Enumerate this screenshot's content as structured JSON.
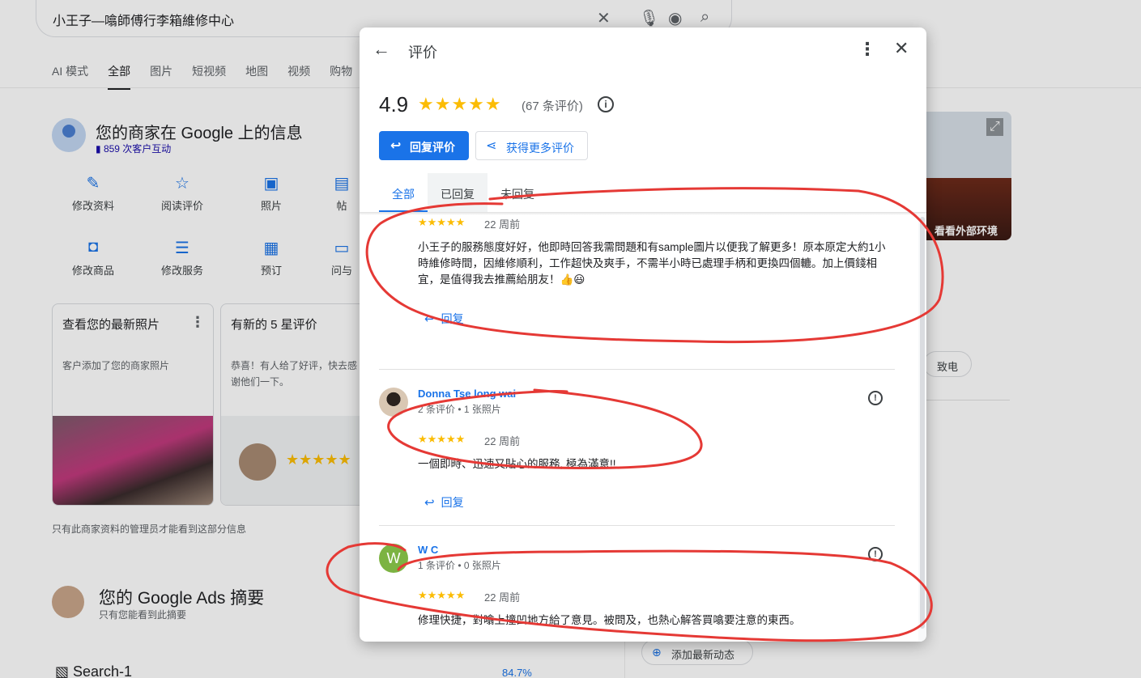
{
  "search": {
    "query": "小王子—噏師傅行李箱維修中心"
  },
  "nav_tabs": [
    "AI 模式",
    "全部",
    "图片",
    "短视频",
    "地图",
    "视频",
    "购物"
  ],
  "business": {
    "title": "您的商家在 Google 上的信息",
    "interactions": "859 次客户互动",
    "actions": [
      "修改资料",
      "阅读评价",
      "照片",
      "帖",
      "修改商品",
      "修改服务",
      "预订",
      "问与"
    ],
    "cards": [
      {
        "title": "查看您的最新照片",
        "desc": "客户添加了您的商家照片"
      },
      {
        "title": "有新的 5 星评价",
        "desc": "恭喜！有人给了好评，快去感谢他们一下。"
      }
    ],
    "note": "只有此商家资料的管理员才能看到这部分信息"
  },
  "ads": {
    "title": "您的 Google Ads 摘要",
    "subtitle": "只有您能看到此摘要",
    "campaign": "Search-1",
    "pct": "84.7%"
  },
  "side": {
    "map_label": "看看外部环境",
    "call": "致电",
    "add_update": "添加最新动态"
  },
  "modal": {
    "title": "评价",
    "rating": "4.9",
    "stars": "★★★★★",
    "count": "(67 条评价)",
    "reply_button": "回复评价",
    "more_reviews_button": "获得更多评价",
    "tabs": [
      "全部",
      "已回复",
      "未回复"
    ],
    "reply_label": "回复",
    "reviews": [
      {
        "name": "",
        "meta": "",
        "stars": "★★★★★",
        "when": "22 周前",
        "text": "小王子的服務態度好好，他即時回答我需問題和有sample圖片以便我了解更多！原本原定大約1小時維修時間，因維修順利，工作超快及爽手，不需半小時已處理手柄和更換四個轆。加上價錢相宜，是值得我去推薦給朋友！👍😃"
      },
      {
        "name": "Donna Tse long wai",
        "meta": "2 条评价 • 1 张照片",
        "stars": "★★★★★",
        "when": "22 周前",
        "text": "一個即時、迅速又貼心的服務, 極為滿意!!"
      },
      {
        "name": "W C",
        "initial": "W",
        "meta": "1 条评价 • 0 张照片",
        "stars": "★★★★★",
        "when": "22 周前",
        "text": "修理快捷，對噏上撞凹地方給了意見。被問及，也熱心解答買噏要注意的東西。"
      }
    ]
  },
  "colors": {
    "accent": "#1a73e8",
    "star": "#fbbc04",
    "annotation": "#e53935"
  }
}
